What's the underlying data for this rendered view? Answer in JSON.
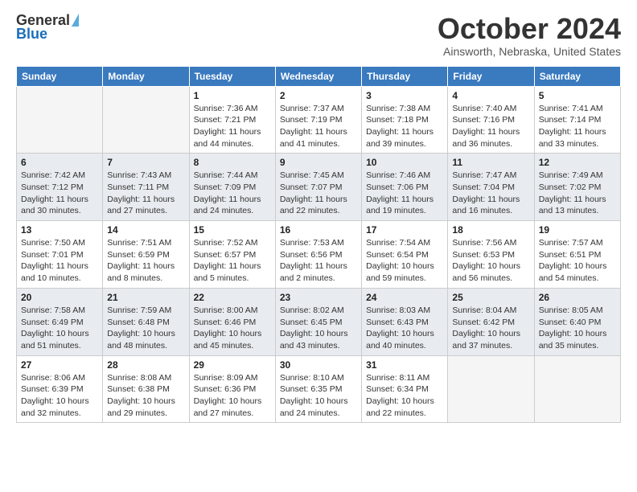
{
  "header": {
    "logo_line1": "General",
    "logo_line2": "Blue",
    "month": "October 2024",
    "location": "Ainsworth, Nebraska, United States"
  },
  "weekdays": [
    "Sunday",
    "Monday",
    "Tuesday",
    "Wednesday",
    "Thursday",
    "Friday",
    "Saturday"
  ],
  "weeks": [
    [
      {
        "num": "",
        "sunrise": "",
        "sunset": "",
        "daylight": "",
        "empty": true
      },
      {
        "num": "",
        "sunrise": "",
        "sunset": "",
        "daylight": "",
        "empty": true
      },
      {
        "num": "1",
        "sunrise": "Sunrise: 7:36 AM",
        "sunset": "Sunset: 7:21 PM",
        "daylight": "Daylight: 11 hours and 44 minutes.",
        "empty": false
      },
      {
        "num": "2",
        "sunrise": "Sunrise: 7:37 AM",
        "sunset": "Sunset: 7:19 PM",
        "daylight": "Daylight: 11 hours and 41 minutes.",
        "empty": false
      },
      {
        "num": "3",
        "sunrise": "Sunrise: 7:38 AM",
        "sunset": "Sunset: 7:18 PM",
        "daylight": "Daylight: 11 hours and 39 minutes.",
        "empty": false
      },
      {
        "num": "4",
        "sunrise": "Sunrise: 7:40 AM",
        "sunset": "Sunset: 7:16 PM",
        "daylight": "Daylight: 11 hours and 36 minutes.",
        "empty": false
      },
      {
        "num": "5",
        "sunrise": "Sunrise: 7:41 AM",
        "sunset": "Sunset: 7:14 PM",
        "daylight": "Daylight: 11 hours and 33 minutes.",
        "empty": false
      }
    ],
    [
      {
        "num": "6",
        "sunrise": "Sunrise: 7:42 AM",
        "sunset": "Sunset: 7:12 PM",
        "daylight": "Daylight: 11 hours and 30 minutes.",
        "empty": false
      },
      {
        "num": "7",
        "sunrise": "Sunrise: 7:43 AM",
        "sunset": "Sunset: 7:11 PM",
        "daylight": "Daylight: 11 hours and 27 minutes.",
        "empty": false
      },
      {
        "num": "8",
        "sunrise": "Sunrise: 7:44 AM",
        "sunset": "Sunset: 7:09 PM",
        "daylight": "Daylight: 11 hours and 24 minutes.",
        "empty": false
      },
      {
        "num": "9",
        "sunrise": "Sunrise: 7:45 AM",
        "sunset": "Sunset: 7:07 PM",
        "daylight": "Daylight: 11 hours and 22 minutes.",
        "empty": false
      },
      {
        "num": "10",
        "sunrise": "Sunrise: 7:46 AM",
        "sunset": "Sunset: 7:06 PM",
        "daylight": "Daylight: 11 hours and 19 minutes.",
        "empty": false
      },
      {
        "num": "11",
        "sunrise": "Sunrise: 7:47 AM",
        "sunset": "Sunset: 7:04 PM",
        "daylight": "Daylight: 11 hours and 16 minutes.",
        "empty": false
      },
      {
        "num": "12",
        "sunrise": "Sunrise: 7:49 AM",
        "sunset": "Sunset: 7:02 PM",
        "daylight": "Daylight: 11 hours and 13 minutes.",
        "empty": false
      }
    ],
    [
      {
        "num": "13",
        "sunrise": "Sunrise: 7:50 AM",
        "sunset": "Sunset: 7:01 PM",
        "daylight": "Daylight: 11 hours and 10 minutes.",
        "empty": false
      },
      {
        "num": "14",
        "sunrise": "Sunrise: 7:51 AM",
        "sunset": "Sunset: 6:59 PM",
        "daylight": "Daylight: 11 hours and 8 minutes.",
        "empty": false
      },
      {
        "num": "15",
        "sunrise": "Sunrise: 7:52 AM",
        "sunset": "Sunset: 6:57 PM",
        "daylight": "Daylight: 11 hours and 5 minutes.",
        "empty": false
      },
      {
        "num": "16",
        "sunrise": "Sunrise: 7:53 AM",
        "sunset": "Sunset: 6:56 PM",
        "daylight": "Daylight: 11 hours and 2 minutes.",
        "empty": false
      },
      {
        "num": "17",
        "sunrise": "Sunrise: 7:54 AM",
        "sunset": "Sunset: 6:54 PM",
        "daylight": "Daylight: 10 hours and 59 minutes.",
        "empty": false
      },
      {
        "num": "18",
        "sunrise": "Sunrise: 7:56 AM",
        "sunset": "Sunset: 6:53 PM",
        "daylight": "Daylight: 10 hours and 56 minutes.",
        "empty": false
      },
      {
        "num": "19",
        "sunrise": "Sunrise: 7:57 AM",
        "sunset": "Sunset: 6:51 PM",
        "daylight": "Daylight: 10 hours and 54 minutes.",
        "empty": false
      }
    ],
    [
      {
        "num": "20",
        "sunrise": "Sunrise: 7:58 AM",
        "sunset": "Sunset: 6:49 PM",
        "daylight": "Daylight: 10 hours and 51 minutes.",
        "empty": false
      },
      {
        "num": "21",
        "sunrise": "Sunrise: 7:59 AM",
        "sunset": "Sunset: 6:48 PM",
        "daylight": "Daylight: 10 hours and 48 minutes.",
        "empty": false
      },
      {
        "num": "22",
        "sunrise": "Sunrise: 8:00 AM",
        "sunset": "Sunset: 6:46 PM",
        "daylight": "Daylight: 10 hours and 45 minutes.",
        "empty": false
      },
      {
        "num": "23",
        "sunrise": "Sunrise: 8:02 AM",
        "sunset": "Sunset: 6:45 PM",
        "daylight": "Daylight: 10 hours and 43 minutes.",
        "empty": false
      },
      {
        "num": "24",
        "sunrise": "Sunrise: 8:03 AM",
        "sunset": "Sunset: 6:43 PM",
        "daylight": "Daylight: 10 hours and 40 minutes.",
        "empty": false
      },
      {
        "num": "25",
        "sunrise": "Sunrise: 8:04 AM",
        "sunset": "Sunset: 6:42 PM",
        "daylight": "Daylight: 10 hours and 37 minutes.",
        "empty": false
      },
      {
        "num": "26",
        "sunrise": "Sunrise: 8:05 AM",
        "sunset": "Sunset: 6:40 PM",
        "daylight": "Daylight: 10 hours and 35 minutes.",
        "empty": false
      }
    ],
    [
      {
        "num": "27",
        "sunrise": "Sunrise: 8:06 AM",
        "sunset": "Sunset: 6:39 PM",
        "daylight": "Daylight: 10 hours and 32 minutes.",
        "empty": false
      },
      {
        "num": "28",
        "sunrise": "Sunrise: 8:08 AM",
        "sunset": "Sunset: 6:38 PM",
        "daylight": "Daylight: 10 hours and 29 minutes.",
        "empty": false
      },
      {
        "num": "29",
        "sunrise": "Sunrise: 8:09 AM",
        "sunset": "Sunset: 6:36 PM",
        "daylight": "Daylight: 10 hours and 27 minutes.",
        "empty": false
      },
      {
        "num": "30",
        "sunrise": "Sunrise: 8:10 AM",
        "sunset": "Sunset: 6:35 PM",
        "daylight": "Daylight: 10 hours and 24 minutes.",
        "empty": false
      },
      {
        "num": "31",
        "sunrise": "Sunrise: 8:11 AM",
        "sunset": "Sunset: 6:34 PM",
        "daylight": "Daylight: 10 hours and 22 minutes.",
        "empty": false
      },
      {
        "num": "",
        "sunrise": "",
        "sunset": "",
        "daylight": "",
        "empty": true
      },
      {
        "num": "",
        "sunrise": "",
        "sunset": "",
        "daylight": "",
        "empty": true
      }
    ]
  ]
}
